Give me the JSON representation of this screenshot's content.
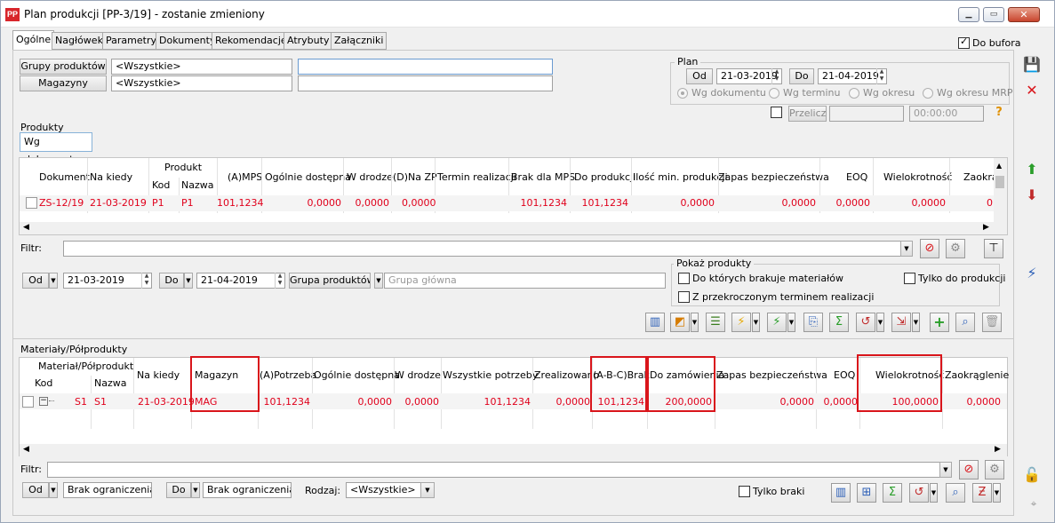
{
  "window": {
    "title": "Plan produkcji [PP-3/19] - zostanie zmieniony",
    "app_icon": "PP",
    "minimize_icon": "minimize-icon",
    "maximize_icon": "maximize-icon",
    "close_icon": "close-icon"
  },
  "tabs": [
    "Ogólne",
    "Nagłówek",
    "Parametry",
    "Dokumenty",
    "Rekomendacje",
    "Atrybuty",
    "Załączniki"
  ],
  "do_bufora": {
    "label": "Do bufora",
    "checked": true
  },
  "filters": {
    "grupy_label": "Grupy produktów",
    "grupy_value": "<Wszystkie>",
    "magazyny_label": "Magazyny",
    "magazyny_value": "<Wszystkie>"
  },
  "plan": {
    "label": "Plan",
    "od_label": "Od",
    "od_value": "21-03-2019",
    "do_label": "Do",
    "do_value": "21-04-2019",
    "radios": [
      "Wg dokumentu",
      "Wg terminu",
      "Wg okresu",
      "Wg okresu MRP"
    ],
    "przelicz_label": "Przelicz",
    "time_value": "00:00:00"
  },
  "produkty": {
    "section_label": "Produkty",
    "subtab": "Wg dokumentu",
    "headers": {
      "dokument": "Dokument",
      "na_kiedy": "Na kiedy",
      "produkt": "Produkt",
      "kod": "Kod",
      "nazwa": "Nazwa",
      "mps": "(A)MPS",
      "ogolnie": "Ogólnie dostępna",
      "w_drodze": "W drodze",
      "na_zp": "(D)Na ZP",
      "termin": "Termin realizacji",
      "brak_mps": "Brak dla MPS",
      "do_produkcji": "Do produkcji",
      "ilosc_min": "Ilość min. produkcji",
      "zapas": "Zapas bezpieczeństwa",
      "eoq": "EOQ",
      "wielokrotnosc": "Wielokrotność",
      "zaokr": "Zaokrą"
    },
    "rows": [
      {
        "dokument": "ZS-12/19",
        "na_kiedy": "21-03-2019",
        "kod": "P1",
        "nazwa": "P1",
        "mps": "101,1234",
        "ogolnie": "0,0000",
        "w_drodze": "0,0000",
        "na_zp": "0,0000",
        "termin": "",
        "brak_mps": "101,1234",
        "do_produkcji": "101,1234",
        "ilosc_min": "0,0000",
        "zapas": "0,0000",
        "eoq": "0,0000",
        "wielokrotnosc": "0,0000",
        "zaokr": "0"
      }
    ],
    "filtr_label": "Filtr:",
    "od_label": "Od",
    "od_value": "21-03-2019",
    "do_label": "Do",
    "do_value": "21-04-2019",
    "grupa_label": "Grupa produktów",
    "grupa_placeholder": "Grupa główna",
    "pokaz_label": "Pokaż produkty",
    "pokaz_opt1": "Do których brakuje materiałów",
    "pokaz_opt2": "Z przekroczonym terminem realizacji",
    "pokaz_opt3": "Tylko do produkcji"
  },
  "materialy": {
    "section_label": "Materiały/Półprodukty",
    "headers": {
      "material": "Materiał/Półprodukt",
      "kod": "Kod",
      "nazwa": "Nazwa",
      "na_kiedy": "Na kiedy",
      "magazyn": "Magazyn",
      "potrzeba": "(A)Potrzeba",
      "ogolnie": "Ogólnie dostępna",
      "w_drodze": "W drodze",
      "wszystkie": "Wszystkie potrzeby",
      "zrealizowano": "Zrealizowano",
      "brak": "(A-B-C)Brak",
      "do_zamowienia": "Do zamówienia",
      "zapas": "Zapas bezpieczeństwa",
      "eoq": "EOQ",
      "wielokrotnosc": "Wielokrotność",
      "zaokraglenie": "Zaokrąglenie"
    },
    "rows": [
      {
        "kod": "S1",
        "nazwa": "S1",
        "na_kiedy": "21-03-2019",
        "magazyn": "MAG",
        "potrzeba": "101,1234",
        "ogolnie": "0,0000",
        "w_drodze": "0,0000",
        "wszystkie": "101,1234",
        "zrealizowano": "0,0000",
        "brak": "101,1234",
        "do_zamowienia": "200,0000",
        "zapas": "0,0000",
        "eoq": "0,0000",
        "wielokrotnosc": "100,0000",
        "zaokraglenie": "0,0000"
      }
    ],
    "filtr_label": "Filtr:",
    "od_label": "Od",
    "od_value": "Brak ograniczenia",
    "do_label": "Do",
    "do_value": "Brak ograniczenia",
    "rodzaj_label": "Rodzaj:",
    "rodzaj_value": "<Wszystkie>",
    "tylko_braki": "Tylko braki"
  },
  "colors": {
    "row_text": "#e0001b",
    "highlight_box": "#d9151b",
    "close_button": "#c8452d"
  }
}
